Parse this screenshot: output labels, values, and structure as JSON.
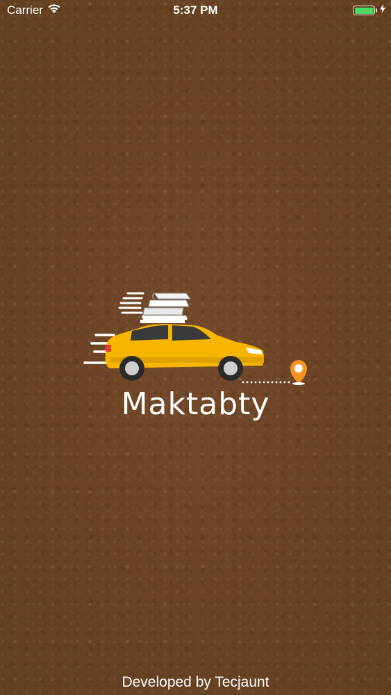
{
  "status_bar": {
    "carrier": "Carrier",
    "time": "5:37 PM",
    "battery_level": 1.0,
    "battery_color": "#4cd964"
  },
  "splash": {
    "app_name": "Maktabty",
    "logo_icons": [
      "car-icon",
      "books-icon",
      "location-pin-icon"
    ],
    "accent_color": "#f7b500"
  },
  "footer": {
    "credit": "Developed by Tecjaunt"
  }
}
